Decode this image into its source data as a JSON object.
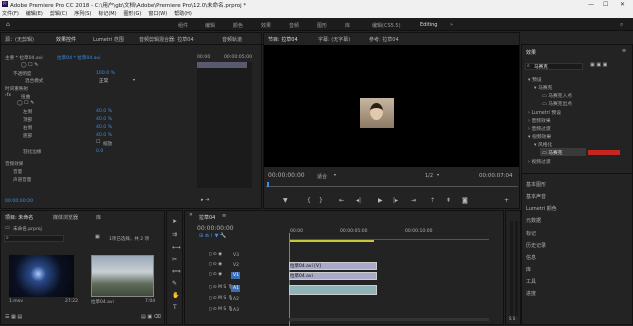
{
  "window": {
    "title": "Adobe Premiere Pro CC 2018 - C:\\用户\\gb\\文档\\Adobe\\Premiere Pro\\12.0\\未命名.prproj *"
  },
  "menu": [
    "文件(F)",
    "编辑(E)",
    "剪辑(C)",
    "序列(S)",
    "标记(M)",
    "图形(G)",
    "窗口(W)",
    "帮助(H)"
  ],
  "workspaces": [
    "组件",
    "编辑",
    "颜色",
    "效果",
    "音频",
    "图形",
    "库",
    "编辑(CS5.5)",
    "Editing"
  ],
  "source_tabs": {
    "source": "源：(无剪辑)",
    "effect_controls": "效果控件",
    "lumetri": "Lumetri 范围",
    "audio_mixer": "音频剪辑混合器: 拉草04",
    "audio_track": "音频轨道"
  },
  "effect_controls": {
    "header_master": "主要 * 拉草04.avi",
    "header_clip": "拉草04 * 拉草04.avi",
    "timecode_start": "00:00",
    "timecode_end": "00:00:05:00",
    "rows": [
      {
        "label": "不透明度",
        "value": "100.0 %"
      },
      {
        "label": "混合模式",
        "value": "正常"
      },
      {
        "label": "时间重映射",
        "value": ""
      },
      {
        "label": "扭曲",
        "value": ""
      },
      {
        "label": "左侧",
        "value": "40.0 %"
      },
      {
        "label": "顶部",
        "value": "40.0 %"
      },
      {
        "label": "右侧",
        "value": "40.0 %"
      },
      {
        "label": "底部",
        "value": "40.0 %"
      },
      {
        "label": "羽化边缘",
        "value": "0.0"
      },
      {
        "label": "音频效果",
        "value": ""
      },
      {
        "label": "音量",
        "value": ""
      },
      {
        "label": "声道音量",
        "value": ""
      }
    ],
    "zoom_label": "缩放",
    "footer_timecode": "00:00:00:00"
  },
  "program": {
    "tabs": [
      "节目: 拉草04",
      "字幕: (无字幕)",
      "参考: 拉草04"
    ],
    "timecode_left": "00:00:00:00",
    "fit": "适合",
    "quality": "1/2",
    "timecode_right": "00:00:07:04"
  },
  "effects_panel": {
    "tabs": [
      "效果"
    ],
    "search_value": "马赛克",
    "tree": [
      {
        "label": "预设",
        "level": 1
      },
      {
        "label": "马赛克",
        "level": 2
      },
      {
        "label": "马赛克入点",
        "level": 3
      },
      {
        "label": "马赛克出点",
        "level": 3
      },
      {
        "label": "Lumetri 预设",
        "level": 1
      },
      {
        "label": "音频效果",
        "level": 1
      },
      {
        "label": "音频过渡",
        "level": 1
      },
      {
        "label": "视频效果",
        "level": 1
      },
      {
        "label": "风格化",
        "level": 2
      },
      {
        "label": "马赛克",
        "level": 3,
        "selected": true
      },
      {
        "label": "视频过渡",
        "level": 1
      }
    ],
    "side_list": [
      "基本图形",
      "基本声音",
      "Lumetri 颜色",
      "元数据",
      "标记",
      "历史记录",
      "信息",
      "库",
      "工具",
      "进度"
    ]
  },
  "project": {
    "tabs": [
      "项目: 未命名",
      "媒体浏览器",
      "库"
    ],
    "project_file": "未命名.prproj",
    "selection_info": "1项已选择，共 2 项",
    "items": [
      {
        "name": "1.mov",
        "duration": "27:22"
      },
      {
        "name": "拉草04.avi",
        "duration": "7:04"
      }
    ]
  },
  "timeline": {
    "tab": "拉草04",
    "timecode": "00:00:00:00",
    "ruler_marks": [
      "00:00",
      "00:00:05:00",
      "00:00:10:00"
    ],
    "video_tracks": [
      "V3",
      "V2",
      "V1"
    ],
    "audio_tracks": [
      "A1",
      "A2",
      "A3"
    ],
    "clips": [
      {
        "track": "V2",
        "label": "拉草04.avi [V]"
      },
      {
        "track": "V1",
        "label": "拉草04.avi"
      },
      {
        "track": "A1",
        "label": ""
      }
    ]
  },
  "colors": {
    "accent": "#3b8ee8",
    "clip_video": "#a9a9c8",
    "clip_audio": "#8fb2b6",
    "timecode": "#3b8ee8",
    "selection": "#e0281e"
  }
}
